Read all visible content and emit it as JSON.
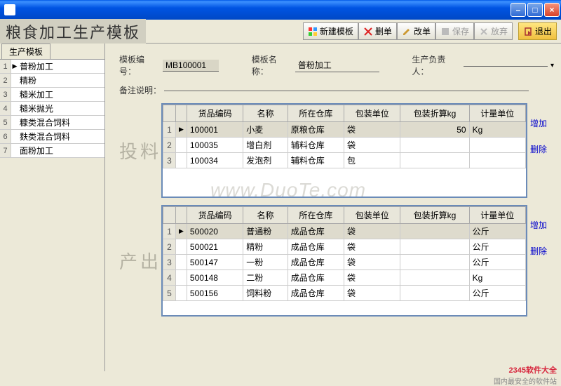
{
  "window": {
    "icon_name": "app-icon"
  },
  "header": {
    "app_title": "粮食加工生产模板",
    "buttons": {
      "new": "新建模板",
      "delete": "删单",
      "modify": "改单",
      "save": "保存",
      "discard": "放弃",
      "exit": "退出"
    }
  },
  "sidebar": {
    "tab": "生产模板",
    "items": [
      {
        "n": "1",
        "text": "普粉加工",
        "selected": true
      },
      {
        "n": "2",
        "text": "精粉",
        "selected": false
      },
      {
        "n": "3",
        "text": "糙米加工",
        "selected": false
      },
      {
        "n": "4",
        "text": "糙米抛光",
        "selected": false
      },
      {
        "n": "5",
        "text": "糠类混合饲料",
        "selected": false
      },
      {
        "n": "6",
        "text": "麸类混合饲料",
        "selected": false
      },
      {
        "n": "7",
        "text": "面粉加工",
        "selected": false
      }
    ]
  },
  "form": {
    "template_no_label": "模板编号：",
    "template_no": "MB100001",
    "template_name_label": "模板名称：",
    "template_name": "普粉加工",
    "owner_label": "生产负责人：",
    "owner": "",
    "remark_label": "备注说明：",
    "remark": ""
  },
  "sections": {
    "input": {
      "title": "投料",
      "add": "增加",
      "del": "删除",
      "columns": [
        "货品编码",
        "名称",
        "所在仓库",
        "包装单位",
        "包装折算kg",
        "计量单位"
      ],
      "rows": [
        {
          "n": "1",
          "code": "100001",
          "name": "小麦",
          "wh": "原粮仓库",
          "pack": "袋",
          "conv": "50",
          "unit": "Kg",
          "sel": true
        },
        {
          "n": "2",
          "code": "100035",
          "name": "增白剂",
          "wh": "辅料仓库",
          "pack": "袋",
          "conv": "",
          "unit": "",
          "sel": false
        },
        {
          "n": "3",
          "code": "100034",
          "name": "发泡剂",
          "wh": "辅料仓库",
          "pack": "包",
          "conv": "",
          "unit": "",
          "sel": false
        }
      ]
    },
    "output": {
      "title": "产出",
      "add": "增加",
      "del": "删除",
      "columns": [
        "货品编码",
        "名称",
        "所在仓库",
        "包装单位",
        "包装折算kg",
        "计量单位"
      ],
      "rows": [
        {
          "n": "1",
          "code": "500020",
          "name": "普通粉",
          "wh": "成品仓库",
          "pack": "袋",
          "conv": "",
          "unit": "公斤",
          "sel": true
        },
        {
          "n": "2",
          "code": "500021",
          "name": "精粉",
          "wh": "成品仓库",
          "pack": "袋",
          "conv": "",
          "unit": "公斤",
          "sel": false
        },
        {
          "n": "3",
          "code": "500147",
          "name": "一粉",
          "wh": "成品仓库",
          "pack": "袋",
          "conv": "",
          "unit": "公斤",
          "sel": false
        },
        {
          "n": "4",
          "code": "500148",
          "name": "二粉",
          "wh": "成品仓库",
          "pack": "袋",
          "conv": "",
          "unit": "Kg",
          "sel": false
        },
        {
          "n": "5",
          "code": "500156",
          "name": "饲料粉",
          "wh": "成品仓库",
          "pack": "袋",
          "conv": "",
          "unit": "公斤",
          "sel": false
        }
      ]
    }
  },
  "watermark": "www.DuoTe.com",
  "footer": {
    "brand": "2345软件大全",
    "sub": "国内最安全的软件站"
  }
}
